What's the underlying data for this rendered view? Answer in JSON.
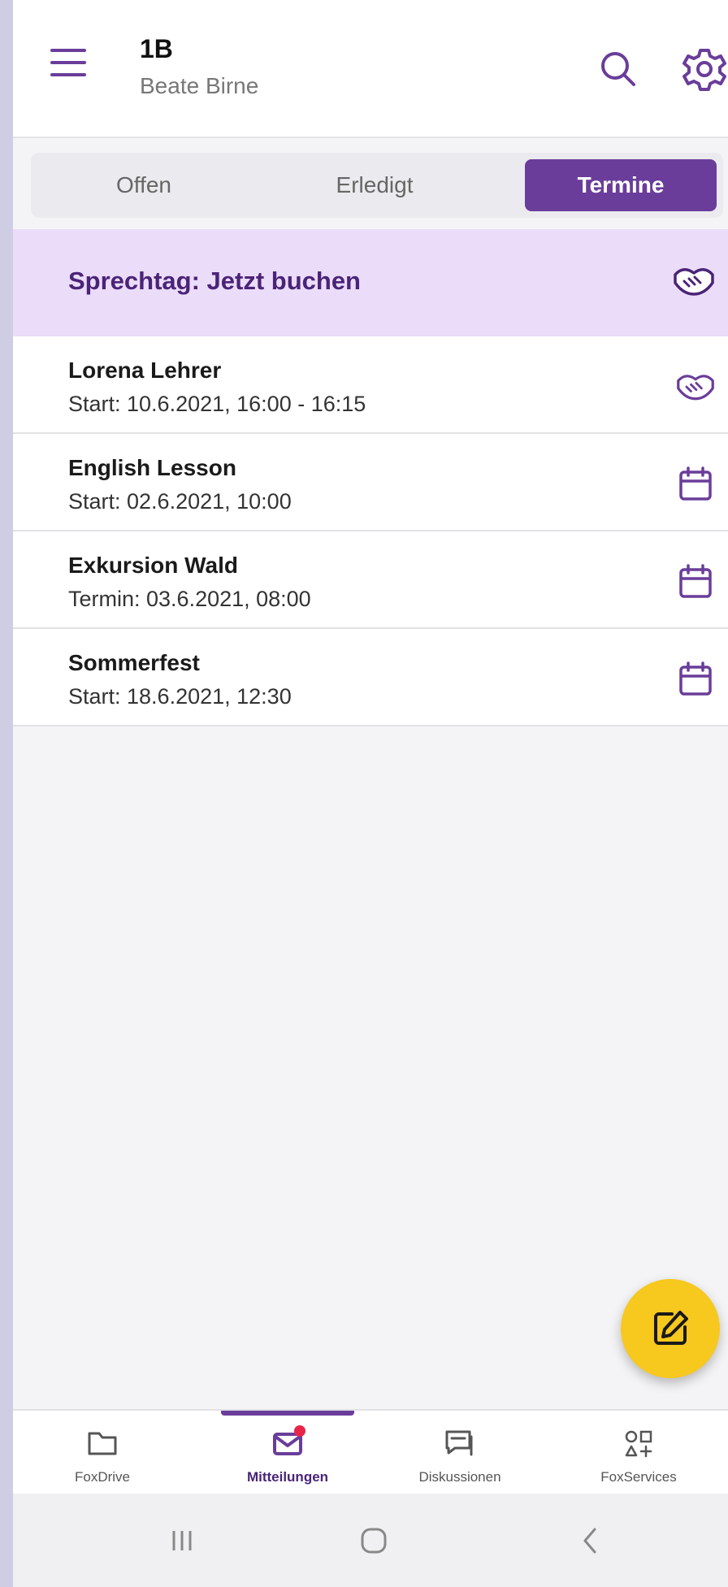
{
  "header": {
    "class_name": "1B",
    "user_name": "Beate Birne",
    "icons": [
      "menu-icon",
      "search-icon",
      "gear-icon"
    ]
  },
  "tabs": [
    {
      "label": "Offen",
      "active": false
    },
    {
      "label": "Erledigt",
      "active": false
    },
    {
      "label": "Termine",
      "active": true
    }
  ],
  "banner": {
    "label": "Sprechtag: Jetzt buchen",
    "icon": "handshake-icon"
  },
  "appointments": [
    {
      "title": "Lorena Lehrer",
      "subtitle": "Start: 10.6.2021, 16:00 - 16:15",
      "icon": "handshake-icon"
    },
    {
      "title": "English Lesson",
      "subtitle": "Start: 02.6.2021, 10:00",
      "icon": "calendar-icon"
    },
    {
      "title": "Exkursion Wald",
      "subtitle": "Termin: 03.6.2021, 08:00",
      "icon": "calendar-icon"
    },
    {
      "title": "Sommerfest",
      "subtitle": "Start: 18.6.2021, 12:30",
      "icon": "calendar-icon"
    }
  ],
  "fab": {
    "icon": "edit-icon"
  },
  "bottom_nav": [
    {
      "label": "FoxDrive",
      "icon": "folder-icon",
      "active": false
    },
    {
      "label": "Mitteilungen",
      "icon": "mail-icon",
      "active": true
    },
    {
      "label": "Diskussionen",
      "icon": "chat-icon",
      "active": false
    },
    {
      "label": "FoxServices",
      "icon": "services-icon",
      "active": false
    }
  ],
  "system_nav": [
    "recents-icon",
    "home-icon",
    "back-icon"
  ],
  "colors": {
    "accent": "#6a3d9a",
    "banner_bg": "#ebdcfa",
    "fab": "#f7c81e",
    "badge": "#e8244a"
  }
}
